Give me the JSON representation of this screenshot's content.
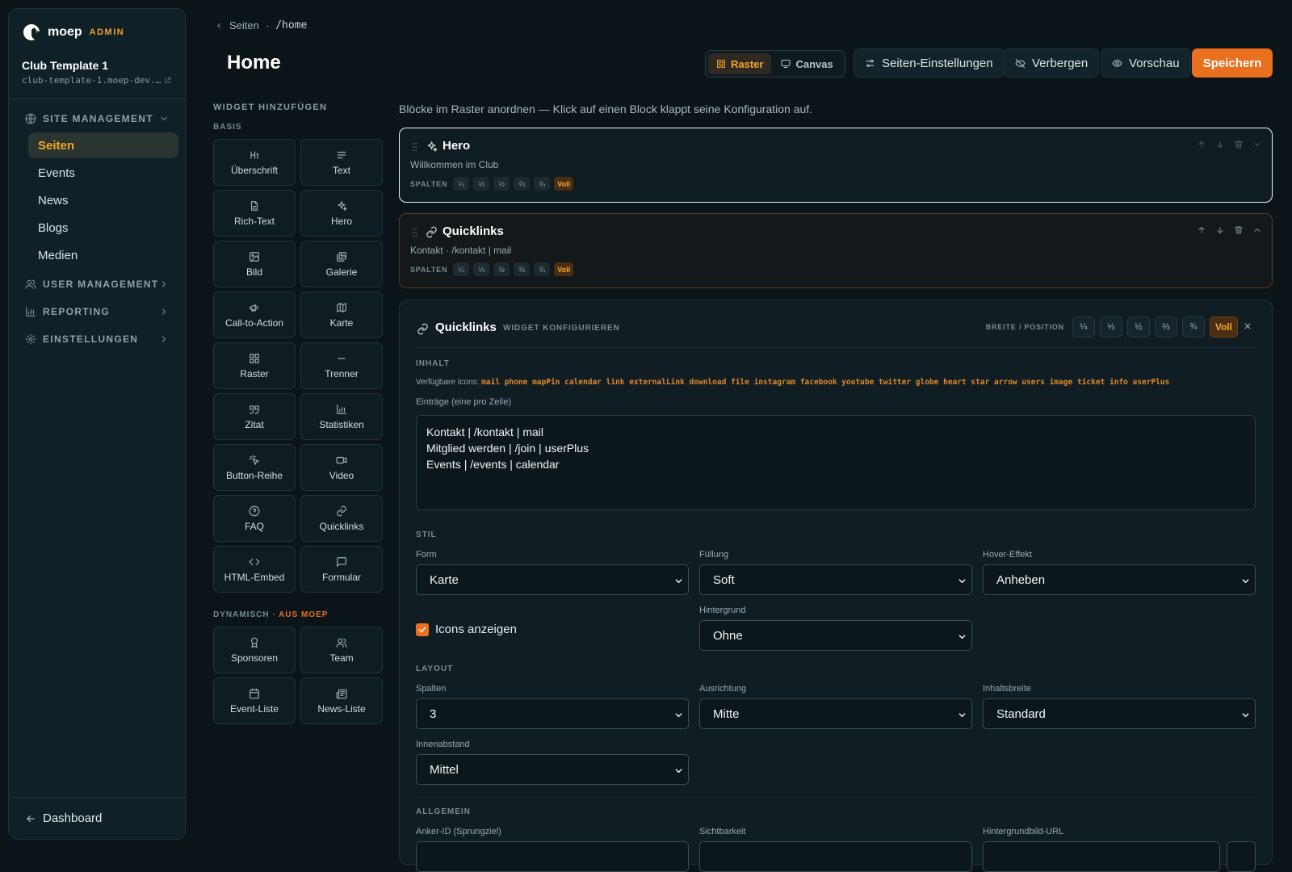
{
  "app": {
    "name": "moep",
    "badge": "ADMIN"
  },
  "club": {
    "name": "Club Template 1",
    "url": "club-template-1.moep-dev.…"
  },
  "sidebar": {
    "sections": [
      {
        "label": "SITE MANAGEMENT",
        "icon": "globe-icon",
        "expanded": true,
        "items": [
          {
            "label": "Seiten",
            "active": true
          },
          {
            "label": "Events"
          },
          {
            "label": "News"
          },
          {
            "label": "Blogs"
          },
          {
            "label": "Medien"
          }
        ]
      },
      {
        "label": "USER MANAGEMENT",
        "icon": "users-icon",
        "expanded": false
      },
      {
        "label": "REPORTING",
        "icon": "bar-chart-icon",
        "expanded": false
      },
      {
        "label": "EINSTELLUNGEN",
        "icon": "gear-icon",
        "expanded": false
      }
    ],
    "dashboard": "Dashboard"
  },
  "header": {
    "breadcrumb": {
      "back": "Seiten",
      "separator": "·",
      "path": "/home"
    },
    "title": "Home",
    "view_toggle": [
      {
        "label": "Raster",
        "active": true
      },
      {
        "label": "Canvas"
      }
    ],
    "buttons": {
      "settings": "Seiten-Einstellungen",
      "hide": "Verbergen",
      "preview": "Vorschau",
      "save": "Speichern"
    },
    "accent": "#e8701f"
  },
  "palette": {
    "title": "WIDGET HINZUFÜGEN",
    "basis_label": "BASIS",
    "basis": [
      {
        "label": "Überschrift",
        "icon": "heading-icon"
      },
      {
        "label": "Text",
        "icon": "text-lines-icon"
      },
      {
        "label": "Rich-Text",
        "icon": "file-text-icon"
      },
      {
        "label": "Hero",
        "icon": "sparkles-icon"
      },
      {
        "label": "Bild",
        "icon": "image-icon"
      },
      {
        "label": "Galerie",
        "icon": "gallery-icon"
      },
      {
        "label": "Call-to-Action",
        "icon": "megaphone-icon"
      },
      {
        "label": "Karte",
        "icon": "map-icon"
      },
      {
        "label": "Raster",
        "icon": "grid-icon"
      },
      {
        "label": "Trenner",
        "icon": "divider-icon"
      },
      {
        "label": "Zitat",
        "icon": "quote-icon"
      },
      {
        "label": "Statistiken",
        "icon": "bar-chart-icon"
      },
      {
        "label": "Button-Reihe",
        "icon": "pointer-click-icon"
      },
      {
        "label": "Video",
        "icon": "video-icon"
      },
      {
        "label": "FAQ",
        "icon": "help-circle-icon"
      },
      {
        "label": "Quicklinks",
        "icon": "link-icon"
      },
      {
        "label": "HTML-Embed",
        "icon": "code-icon"
      },
      {
        "label": "Formular",
        "icon": "message-square-icon"
      }
    ],
    "dynamic_label": "DYNAMISCH",
    "dynamic_accent": "· AUS MOEP",
    "dynamic": [
      {
        "label": "Sponsoren",
        "icon": "award-icon"
      },
      {
        "label": "Team",
        "icon": "users-icon"
      },
      {
        "label": "Event-Liste",
        "icon": "calendar-icon"
      },
      {
        "label": "News-Liste",
        "icon": "newspaper-icon"
      }
    ]
  },
  "content": {
    "hint": "Blöcke im Raster anordnen — Klick auf einen Block klappt seine Konfiguration auf.",
    "columns_label": "SPALTEN",
    "column_options": [
      "¼",
      "⅓",
      "½",
      "⅔",
      "¾",
      "Voll"
    ],
    "blocks": [
      {
        "title": "Hero",
        "subtitle": "Willkommen im Club",
        "icon": "sparkles-icon",
        "width": "Voll"
      },
      {
        "title": "Quicklinks",
        "subtitle": "Kontakt · /kontakt | mail",
        "icon": "link-icon",
        "width": "Voll"
      }
    ]
  },
  "config": {
    "title": "Quicklinks",
    "subtitle": "WIDGET KONFIGURIEREN",
    "width_label": "BREITE / POSITION",
    "width_options": [
      "¼",
      "⅓",
      "½",
      "⅔",
      "¾",
      "Voll"
    ],
    "width_selected": "Voll",
    "content_section": "INHALT",
    "icons_label": "Verfügbare Icons:",
    "icons_list": "mail phone mapPin calendar link externalLink download file instagram facebook youtube twitter globe heart star arrow users image ticket info userPlus",
    "entries_label": "Einträge (eine pro Zeile)",
    "entries": "Kontakt | /kontakt | mail\nMitglied werden | /join | userPlus\nEvents | /events | calendar",
    "style_section": "STIL",
    "form": {
      "label": "Form",
      "value": "Karte"
    },
    "fill": {
      "label": "Füllung",
      "value": "Soft"
    },
    "hover": {
      "label": "Hover-Effekt",
      "value": "Anheben"
    },
    "show_icons": {
      "label": "Icons anzeigen",
      "checked": true
    },
    "background": {
      "label": "Hintergrund",
      "value": "Ohne"
    },
    "layout_section": "LAYOUT",
    "columns": {
      "label": "Spalten",
      "value": "3"
    },
    "alignment": {
      "label": "Ausrichtung",
      "value": "Mitte"
    },
    "content_width": {
      "label": "Inhaltsbreite",
      "value": "Standard"
    },
    "padding": {
      "label": "Innenabstand",
      "value": "Mittel"
    },
    "general_section": "ALLGEMEIN",
    "anchor": {
      "label": "Anker-ID (Sprungziel)"
    },
    "visibility": {
      "label": "Sichtbarkeit"
    },
    "bg_url": {
      "label": "Hintergrundbild-URL"
    }
  }
}
